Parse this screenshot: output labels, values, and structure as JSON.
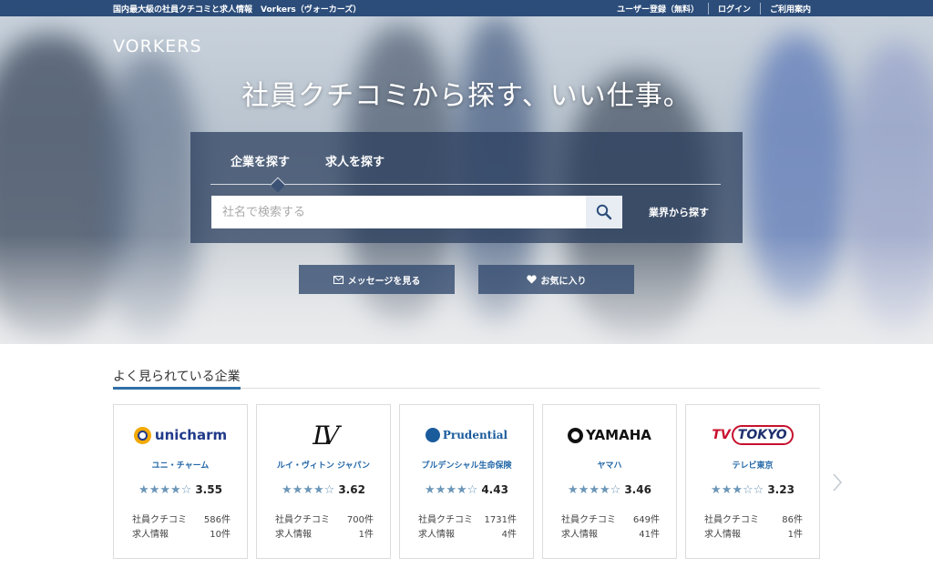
{
  "topbar": {
    "tagline": "国内最大級の社員クチコミと求人情報　Vorkers（ヴォーカーズ）",
    "links": [
      "ユーザー登録（無料）",
      "ログイン",
      "ご利用案内"
    ]
  },
  "hero": {
    "logo": "VORKERS",
    "headline": "社員クチコミから探す、いい仕事。",
    "tabs": [
      "企業を探す",
      "求人を探す"
    ],
    "search_placeholder": "社名で検索する",
    "industry_link": "業界から探す",
    "buttons": {
      "messages": "メッセージを見る",
      "favorites": "お気に入り"
    }
  },
  "popular": {
    "title": "よく見られている企業",
    "review_label": "社員クチコミ",
    "jobs_label": "求人情報",
    "companies": [
      {
        "name": "ユニ・チャーム",
        "logo_text": "unicharm",
        "stars": "★★★★☆",
        "score": "3.55",
        "reviews": "586件",
        "jobs": "10件"
      },
      {
        "name": "ルイ・ヴィトン ジャパン",
        "logo_text": "LV",
        "stars": "★★★★☆",
        "score": "3.62",
        "reviews": "700件",
        "jobs": "1件"
      },
      {
        "name": "プルデンシャル生命保険",
        "logo_text": "Prudential",
        "stars": "★★★★☆",
        "score": "4.43",
        "reviews": "1731件",
        "jobs": "4件"
      },
      {
        "name": "ヤマハ",
        "logo_text": "YAMAHA",
        "stars": "★★★★☆",
        "score": "3.46",
        "reviews": "649件",
        "jobs": "41件"
      },
      {
        "name": "テレビ東京",
        "logo_text_a": "TV",
        "logo_text_b": "TOKYO",
        "stars": "★★★☆☆",
        "score": "3.23",
        "reviews": "86件",
        "jobs": "1件"
      }
    ]
  },
  "colors": {
    "topbar": "#2c4d7a",
    "accent": "#2f70a8",
    "link": "#2468a8",
    "star": "#6b96b8"
  }
}
